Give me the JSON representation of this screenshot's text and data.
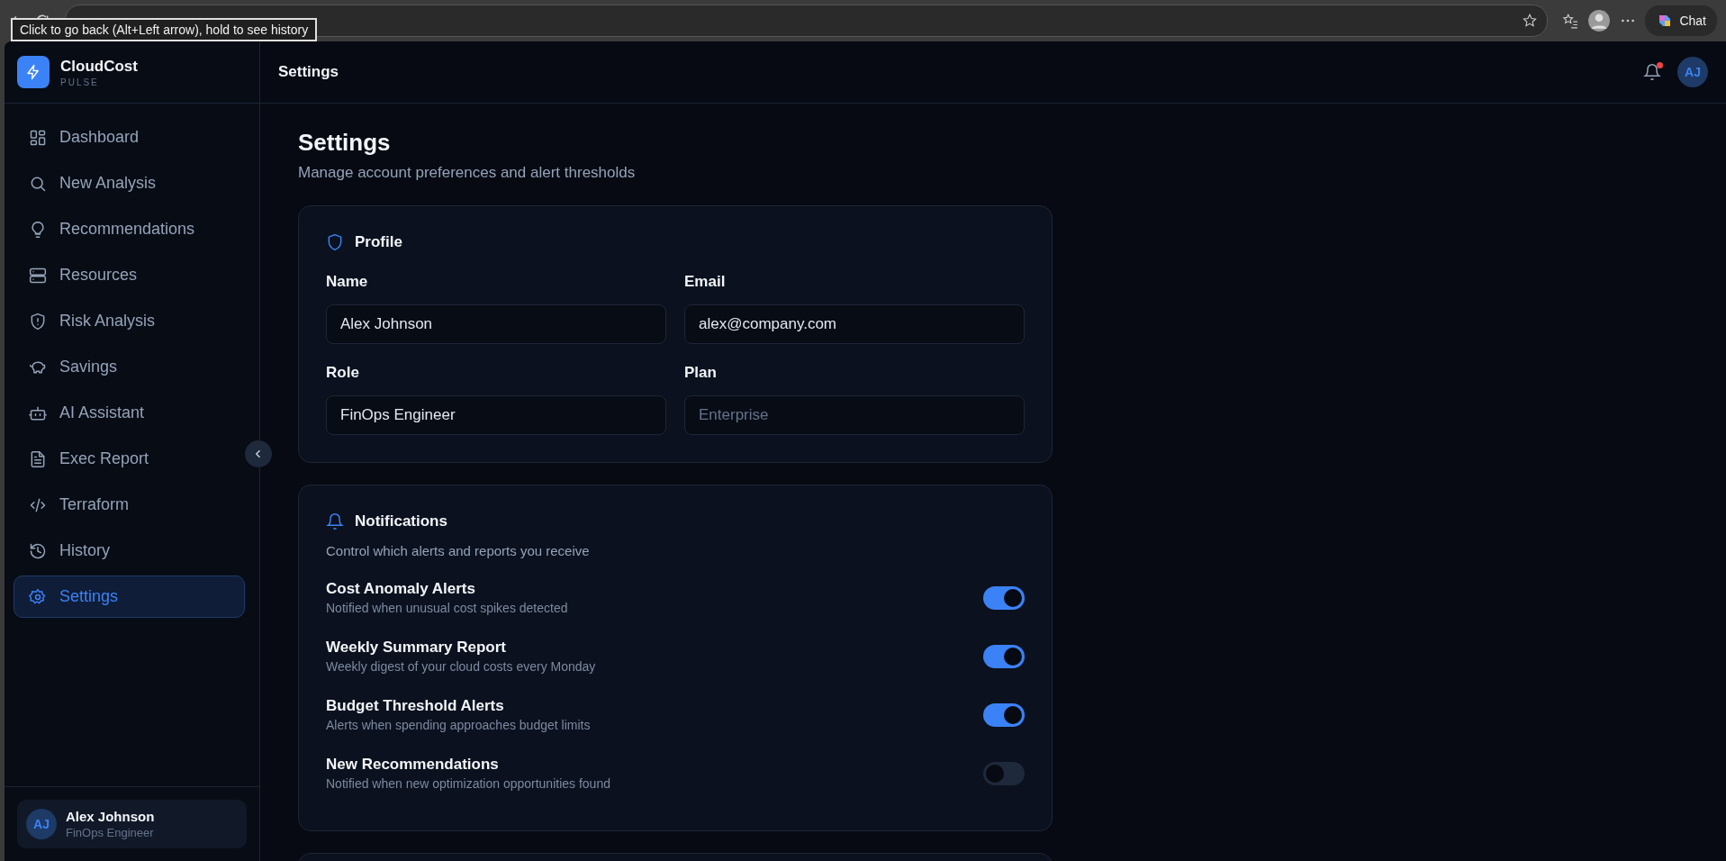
{
  "browser": {
    "tooltip": "Click to go back (Alt+Left arrow), hold to see history",
    "chat_button": "Chat"
  },
  "brand": {
    "name": "CloudCost",
    "tagline": "PULSE"
  },
  "sidebar": {
    "items": [
      {
        "label": "Dashboard",
        "selected": false
      },
      {
        "label": "New Analysis",
        "selected": false
      },
      {
        "label": "Recommendations",
        "selected": false
      },
      {
        "label": "Resources",
        "selected": false
      },
      {
        "label": "Risk Analysis",
        "selected": false
      },
      {
        "label": "Savings",
        "selected": false
      },
      {
        "label": "AI Assistant",
        "selected": false
      },
      {
        "label": "Exec Report",
        "selected": false
      },
      {
        "label": "Terraform",
        "selected": false
      },
      {
        "label": "History",
        "selected": false
      },
      {
        "label": "Settings",
        "selected": true
      }
    ],
    "user": {
      "initials": "AJ",
      "name": "Alex Johnson",
      "role": "FinOps Engineer"
    }
  },
  "header": {
    "title": "Settings",
    "notification_dot": true,
    "avatar": "AJ"
  },
  "page": {
    "title": "Settings",
    "subtitle": "Manage account preferences and alert thresholds"
  },
  "profile": {
    "title": "Profile",
    "fields": [
      {
        "label": "Name",
        "value": "Alex Johnson",
        "disabled": false
      },
      {
        "label": "Email",
        "value": "alex@company.com",
        "disabled": false
      },
      {
        "label": "Role",
        "value": "FinOps Engineer",
        "disabled": false
      },
      {
        "label": "Plan",
        "value": "Enterprise",
        "disabled": true
      }
    ]
  },
  "notifications": {
    "title": "Notifications",
    "subtitle": "Control which alerts and reports you receive",
    "items": [
      {
        "title": "Cost Anomaly Alerts",
        "description": "Notified when unusual cost spikes detected",
        "on": true
      },
      {
        "title": "Weekly Summary Report",
        "description": "Weekly digest of your cloud costs every Monday",
        "on": true
      },
      {
        "title": "Budget Threshold Alerts",
        "description": "Alerts when spending approaches budget limits",
        "on": true
      },
      {
        "title": "New Recommendations",
        "description": "Notified when new optimization opportunities found",
        "on": false
      }
    ]
  }
}
